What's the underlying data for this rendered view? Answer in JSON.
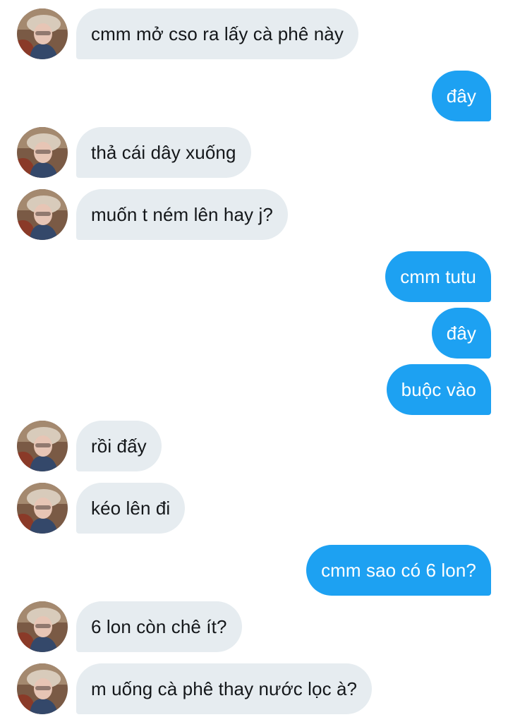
{
  "conversation": {
    "messages": [
      {
        "side": "in",
        "text": "cmm mở cso ra lấy cà phê này"
      },
      {
        "side": "out",
        "text": "đây"
      },
      {
        "side": "in",
        "text": "thả cái dây xuống"
      },
      {
        "side": "in",
        "text": "muốn t ném lên hay j?"
      },
      {
        "side": "out",
        "text": "cmm tutu"
      },
      {
        "side": "out",
        "text": "đây"
      },
      {
        "side": "out",
        "text": "buộc vào"
      },
      {
        "side": "in",
        "text": "rồi đấy"
      },
      {
        "side": "in",
        "text": "kéo lên đi"
      },
      {
        "side": "out",
        "text": "cmm sao có 6 lon?"
      },
      {
        "side": "in",
        "text": "6 lon còn chê ít?"
      },
      {
        "side": "in",
        "text": "m uống cà phê thay nước lọc à?"
      }
    ]
  },
  "colors": {
    "incoming_bubble": "#e6ecf0",
    "outgoing_bubble": "#1da1f2",
    "incoming_text": "#14171a",
    "outgoing_text": "#ffffff"
  }
}
